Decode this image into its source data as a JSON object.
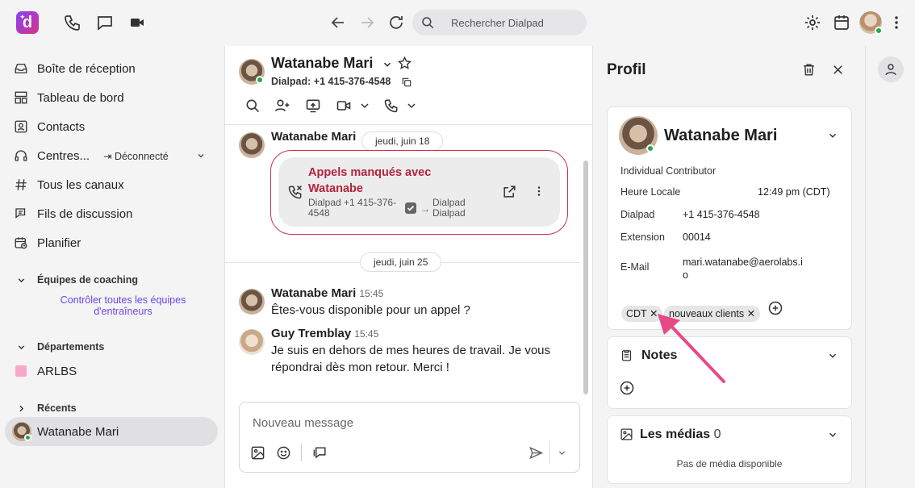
{
  "search": {
    "placeholder": "Rechercher Dialpad"
  },
  "sidebar": {
    "items": [
      {
        "label": "Boîte de réception",
        "icon": "inbox-icon"
      },
      {
        "label": "Tableau de bord",
        "icon": "dashboard-icon"
      },
      {
        "label": "Contacts",
        "icon": "contacts-icon"
      },
      {
        "label": "Centres...",
        "icon": "headset-icon",
        "status": "Déconnecté"
      },
      {
        "label": "Tous les canaux",
        "icon": "hash-icon"
      },
      {
        "label": "Fils de discussion",
        "icon": "threads-icon"
      },
      {
        "label": "Planifier",
        "icon": "calendar-clock-icon"
      }
    ],
    "coaching": {
      "title": "Équipes de coaching",
      "link": "Contrôler toutes les équipes d'entraîneurs"
    },
    "departments": {
      "title": "Départements",
      "items": [
        {
          "label": "ARLBS",
          "color": "#f8a8c8"
        }
      ]
    },
    "recents": {
      "title": "Récents",
      "items": [
        {
          "label": "Watanabe Mari"
        }
      ]
    }
  },
  "chat": {
    "contact_name": "Watanabe Mari",
    "contact_sub": "Dialpad: +1 415-376-4548",
    "day1": "jeudi, juin 18",
    "day2": "jeudi, juin 25",
    "missed": {
      "sender": "Watanabe Mari",
      "title": "Appels manqués avec Watanabe",
      "from_line1": "Dialpad +1 415-376-",
      "from_line2": "4548",
      "to_line1": "Dialpad",
      "to_line2": "Dialpad"
    },
    "messages": [
      {
        "name": "Watanabe Mari",
        "time": "15:45",
        "text": "Êtes-vous disponible pour un appel ?"
      },
      {
        "name": "Guy Tremblay",
        "time": "15:45",
        "text": "Je suis en dehors de mes heures de travail. Je vous répondrai dès mon retour. Merci !"
      }
    ],
    "compose_placeholder": "Nouveau message"
  },
  "profile": {
    "title": "Profil",
    "name": "Watanabe Mari",
    "role": "Individual Contributor",
    "fields": [
      {
        "label": "Heure Locale",
        "value": "12:49 pm (CDT)"
      },
      {
        "label": "Dialpad",
        "value": "+1 415-376-4548"
      },
      {
        "label": "Extension",
        "value": "00014"
      },
      {
        "label": "E-Mail",
        "value": "mari.watanabe@aerolabs.i",
        "value2": "o"
      }
    ],
    "tags": [
      "CDT",
      "nouveaux clients"
    ],
    "notes_title": "Notes",
    "media_title": "Les médias",
    "media_count": "0",
    "media_empty": "Pas de média disponible"
  },
  "colors": {
    "accent": "#6b46e6",
    "missed": "#b3243f",
    "online": "#2da44e",
    "arrow": "#e64a86"
  }
}
